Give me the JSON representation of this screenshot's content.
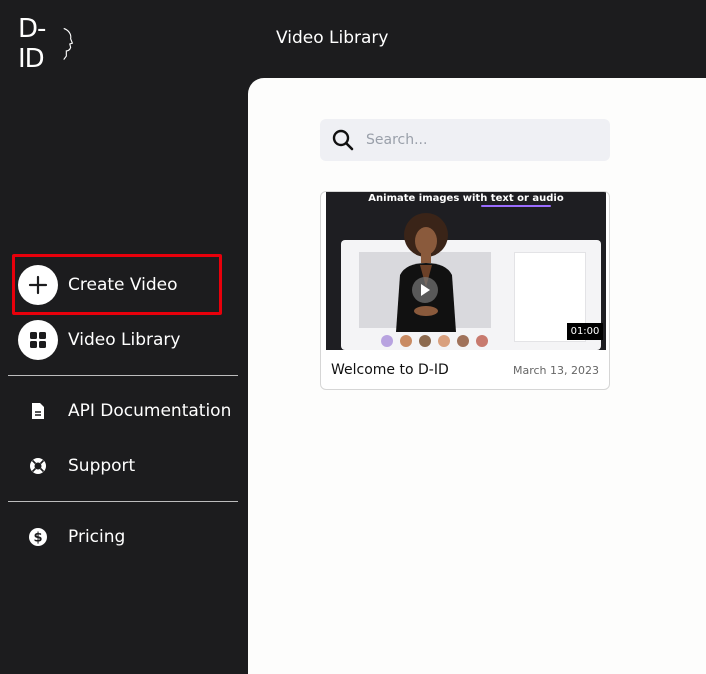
{
  "app": {
    "logo_text": "D-ID"
  },
  "header": {
    "title": "Video Library"
  },
  "sidebar": {
    "items": [
      {
        "label": "Create Video",
        "icon": "plus-icon"
      },
      {
        "label": "Video Library",
        "icon": "grid-icon"
      },
      {
        "label": "API Documentation",
        "icon": "document-icon"
      },
      {
        "label": "Support",
        "icon": "lifebuoy-icon"
      },
      {
        "label": "Pricing",
        "icon": "dollar-icon"
      }
    ]
  },
  "search": {
    "placeholder": "Search...",
    "value": ""
  },
  "videos": [
    {
      "title": "Welcome to D-ID",
      "date": "March 13, 2023",
      "duration": "01:00",
      "thumbnail_caption": "Animate images with text or audio"
    }
  ],
  "colors": {
    "sidebar_bg": "#1c1c1e",
    "highlight": "#e8000b",
    "main_bg": "#fdfdfc",
    "search_bg": "#eff0f4"
  }
}
